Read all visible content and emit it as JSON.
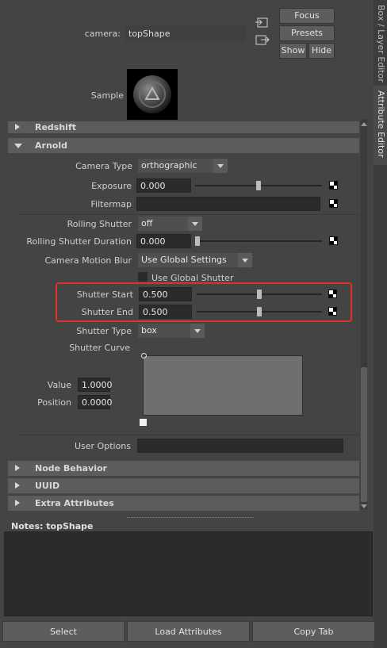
{
  "header": {
    "camera_label": "camera:",
    "camera_value": "topShape",
    "focus_label": "Focus",
    "presets_label": "Presets",
    "show_label": "Show",
    "hide_label": "Hide",
    "sample_label": "Sample"
  },
  "side_tabs": {
    "box_layer_editor": "Box / Layer Editor",
    "attribute_editor": "Attribute Editor"
  },
  "sections": {
    "redshift": "Redshift",
    "arnold": "Arnold",
    "node_behavior": "Node Behavior",
    "uuid": "UUID",
    "extra_attributes": "Extra Attributes"
  },
  "arnold": {
    "camera_type_label": "Camera Type",
    "camera_type_value": "orthographic",
    "exposure_label": "Exposure",
    "exposure_value": "0.000",
    "filtermap_label": "Filtermap",
    "rolling_shutter_label": "Rolling Shutter",
    "rolling_shutter_value": "off",
    "rolling_shutter_duration_label": "Rolling Shutter Duration",
    "rolling_shutter_duration_value": "0.000",
    "camera_motion_blur_label": "Camera Motion Blur",
    "camera_motion_blur_value": "Use Global Settings",
    "use_global_shutter_label": "Use Global Shutter",
    "shutter_start_label": "Shutter Start",
    "shutter_start_value": "0.500",
    "shutter_end_label": "Shutter End",
    "shutter_end_value": "0.500",
    "shutter_type_label": "Shutter Type",
    "shutter_type_value": "box",
    "shutter_curve_label": "Shutter Curve",
    "value_label": "Value",
    "value_value": "1.0000",
    "position_label": "Position",
    "position_value": "0.0000",
    "user_options_label": "User Options"
  },
  "sliders": {
    "exposure_fraction": 0.5,
    "rolling_shutter_duration_fraction": 0.0,
    "shutter_start_fraction": 0.5,
    "shutter_end_fraction": 0.5
  },
  "notes": {
    "label": "Notes:  topShape"
  },
  "bottom": {
    "select_label": "Select",
    "load_attributes_label": "Load Attributes",
    "copy_tab_label": "Copy Tab"
  },
  "colors": {
    "highlight_box": "#e0312b",
    "panel_bg": "#444444"
  },
  "icons": {
    "sample_swatch": "arnold-shader-ball-icon"
  }
}
